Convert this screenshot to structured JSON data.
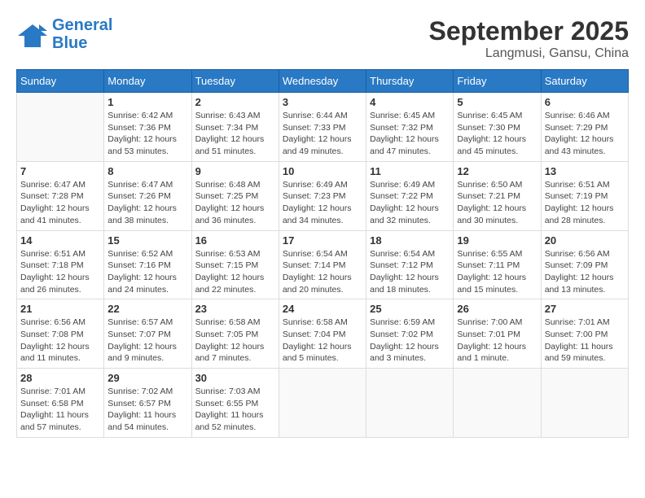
{
  "header": {
    "logo_line1": "General",
    "logo_line2": "Blue",
    "month": "September 2025",
    "location": "Langmusi, Gansu, China"
  },
  "weekdays": [
    "Sunday",
    "Monday",
    "Tuesday",
    "Wednesday",
    "Thursday",
    "Friday",
    "Saturday"
  ],
  "weeks": [
    [
      {
        "day": "",
        "info": ""
      },
      {
        "day": "1",
        "info": "Sunrise: 6:42 AM\nSunset: 7:36 PM\nDaylight: 12 hours\nand 53 minutes."
      },
      {
        "day": "2",
        "info": "Sunrise: 6:43 AM\nSunset: 7:34 PM\nDaylight: 12 hours\nand 51 minutes."
      },
      {
        "day": "3",
        "info": "Sunrise: 6:44 AM\nSunset: 7:33 PM\nDaylight: 12 hours\nand 49 minutes."
      },
      {
        "day": "4",
        "info": "Sunrise: 6:45 AM\nSunset: 7:32 PM\nDaylight: 12 hours\nand 47 minutes."
      },
      {
        "day": "5",
        "info": "Sunrise: 6:45 AM\nSunset: 7:30 PM\nDaylight: 12 hours\nand 45 minutes."
      },
      {
        "day": "6",
        "info": "Sunrise: 6:46 AM\nSunset: 7:29 PM\nDaylight: 12 hours\nand 43 minutes."
      }
    ],
    [
      {
        "day": "7",
        "info": "Sunrise: 6:47 AM\nSunset: 7:28 PM\nDaylight: 12 hours\nand 41 minutes."
      },
      {
        "day": "8",
        "info": "Sunrise: 6:47 AM\nSunset: 7:26 PM\nDaylight: 12 hours\nand 38 minutes."
      },
      {
        "day": "9",
        "info": "Sunrise: 6:48 AM\nSunset: 7:25 PM\nDaylight: 12 hours\nand 36 minutes."
      },
      {
        "day": "10",
        "info": "Sunrise: 6:49 AM\nSunset: 7:23 PM\nDaylight: 12 hours\nand 34 minutes."
      },
      {
        "day": "11",
        "info": "Sunrise: 6:49 AM\nSunset: 7:22 PM\nDaylight: 12 hours\nand 32 minutes."
      },
      {
        "day": "12",
        "info": "Sunrise: 6:50 AM\nSunset: 7:21 PM\nDaylight: 12 hours\nand 30 minutes."
      },
      {
        "day": "13",
        "info": "Sunrise: 6:51 AM\nSunset: 7:19 PM\nDaylight: 12 hours\nand 28 minutes."
      }
    ],
    [
      {
        "day": "14",
        "info": "Sunrise: 6:51 AM\nSunset: 7:18 PM\nDaylight: 12 hours\nand 26 minutes."
      },
      {
        "day": "15",
        "info": "Sunrise: 6:52 AM\nSunset: 7:16 PM\nDaylight: 12 hours\nand 24 minutes."
      },
      {
        "day": "16",
        "info": "Sunrise: 6:53 AM\nSunset: 7:15 PM\nDaylight: 12 hours\nand 22 minutes."
      },
      {
        "day": "17",
        "info": "Sunrise: 6:54 AM\nSunset: 7:14 PM\nDaylight: 12 hours\nand 20 minutes."
      },
      {
        "day": "18",
        "info": "Sunrise: 6:54 AM\nSunset: 7:12 PM\nDaylight: 12 hours\nand 18 minutes."
      },
      {
        "day": "19",
        "info": "Sunrise: 6:55 AM\nSunset: 7:11 PM\nDaylight: 12 hours\nand 15 minutes."
      },
      {
        "day": "20",
        "info": "Sunrise: 6:56 AM\nSunset: 7:09 PM\nDaylight: 12 hours\nand 13 minutes."
      }
    ],
    [
      {
        "day": "21",
        "info": "Sunrise: 6:56 AM\nSunset: 7:08 PM\nDaylight: 12 hours\nand 11 minutes."
      },
      {
        "day": "22",
        "info": "Sunrise: 6:57 AM\nSunset: 7:07 PM\nDaylight: 12 hours\nand 9 minutes."
      },
      {
        "day": "23",
        "info": "Sunrise: 6:58 AM\nSunset: 7:05 PM\nDaylight: 12 hours\nand 7 minutes."
      },
      {
        "day": "24",
        "info": "Sunrise: 6:58 AM\nSunset: 7:04 PM\nDaylight: 12 hours\nand 5 minutes."
      },
      {
        "day": "25",
        "info": "Sunrise: 6:59 AM\nSunset: 7:02 PM\nDaylight: 12 hours\nand 3 minutes."
      },
      {
        "day": "26",
        "info": "Sunrise: 7:00 AM\nSunset: 7:01 PM\nDaylight: 12 hours\nand 1 minute."
      },
      {
        "day": "27",
        "info": "Sunrise: 7:01 AM\nSunset: 7:00 PM\nDaylight: 11 hours\nand 59 minutes."
      }
    ],
    [
      {
        "day": "28",
        "info": "Sunrise: 7:01 AM\nSunset: 6:58 PM\nDaylight: 11 hours\nand 57 minutes."
      },
      {
        "day": "29",
        "info": "Sunrise: 7:02 AM\nSunset: 6:57 PM\nDaylight: 11 hours\nand 54 minutes."
      },
      {
        "day": "30",
        "info": "Sunrise: 7:03 AM\nSunset: 6:55 PM\nDaylight: 11 hours\nand 52 minutes."
      },
      {
        "day": "",
        "info": ""
      },
      {
        "day": "",
        "info": ""
      },
      {
        "day": "",
        "info": ""
      },
      {
        "day": "",
        "info": ""
      }
    ]
  ]
}
